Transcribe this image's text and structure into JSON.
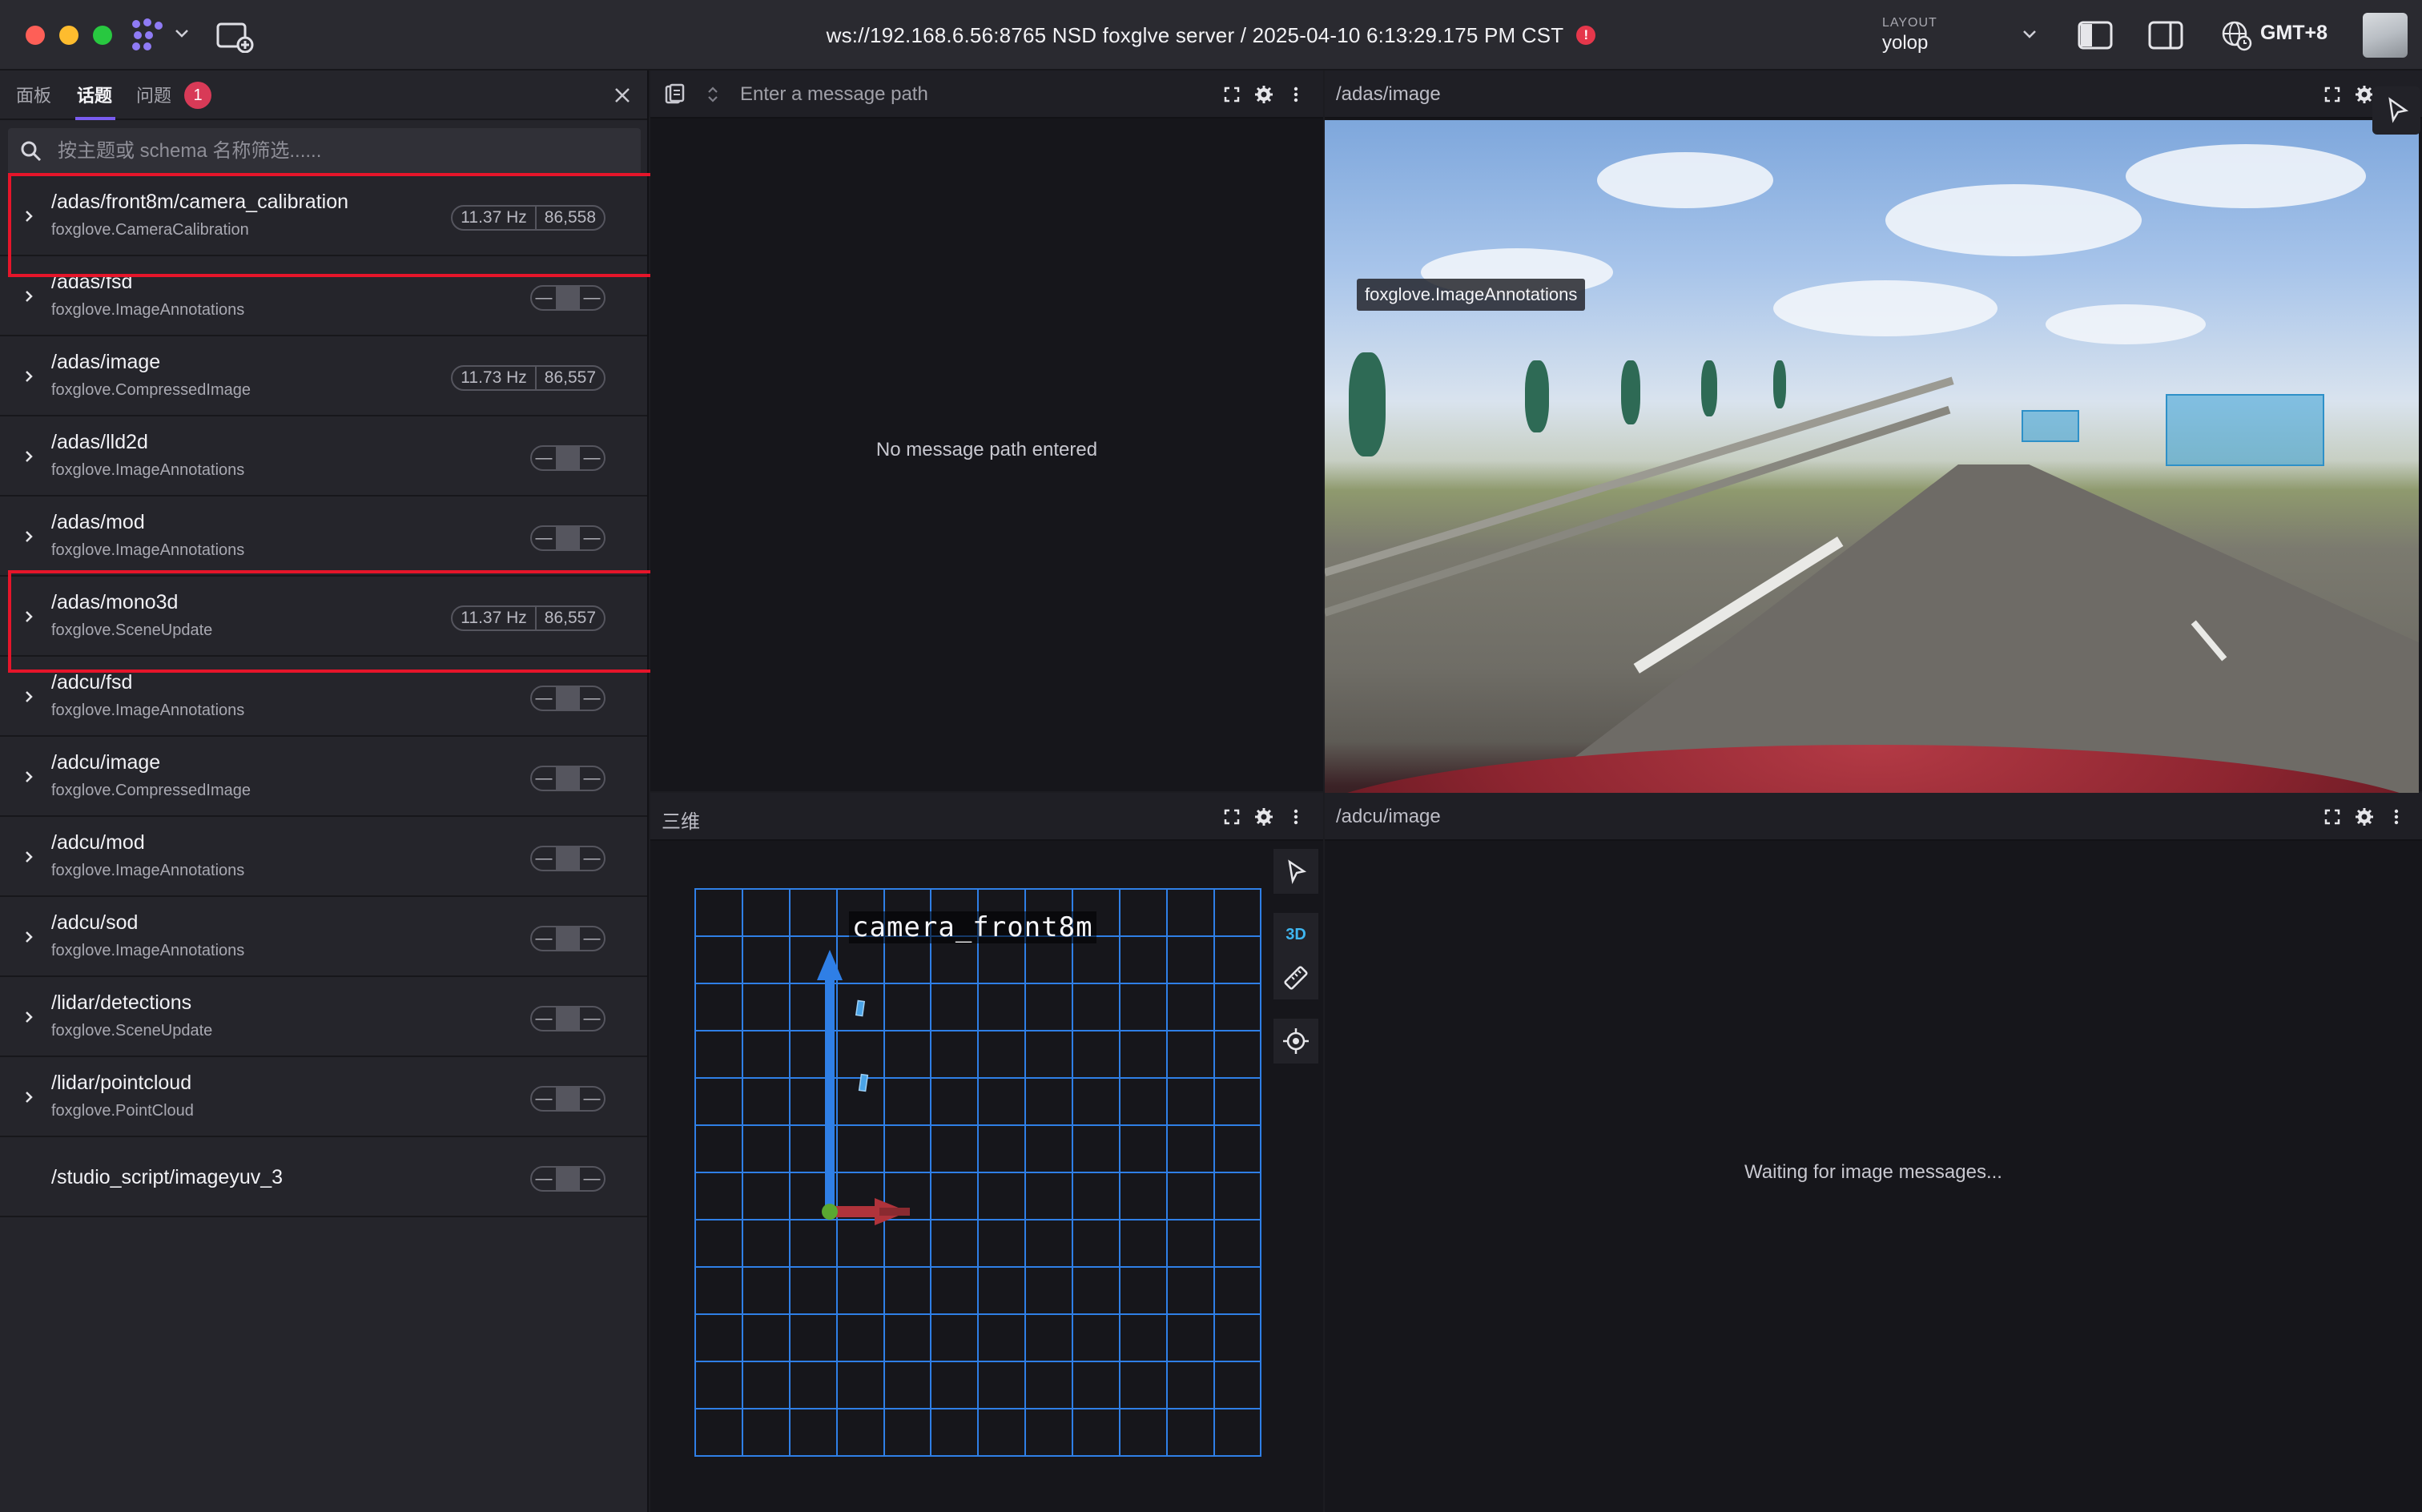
{
  "titlebar": {
    "connection_title": "ws://192.168.6.56:8765 NSD foxglve server / 2025-04-10 6:13:29.175 PM CST",
    "alert_glyph": "!",
    "layout_caption": "LAYOUT",
    "layout_name": "yolop",
    "timezone": "GMT+8",
    "icons": [
      "app-logo-icon",
      "chevron-down-icon",
      "add-window-icon",
      "left-sidebar-icon",
      "right-sidebar-icon",
      "globe-clock-icon"
    ]
  },
  "sidebar": {
    "tabs": [
      "面板",
      "话题",
      "问题"
    ],
    "active_tab": "话题",
    "issue_count": "1",
    "filter_placeholder": "按主题或 schema 名称筛选......",
    "topics": [
      {
        "name": "/adas/front8m/camera_calibration",
        "schema": "foxglove.CameraCalibration",
        "hz": "11.37 Hz",
        "count": "86,558",
        "highlighted": true
      },
      {
        "name": "/adas/fsd",
        "schema": "foxglove.ImageAnnotations",
        "hz": "—",
        "count": "—"
      },
      {
        "name": "/adas/image",
        "schema": "foxglove.CompressedImage",
        "hz": "11.73 Hz",
        "count": "86,557"
      },
      {
        "name": "/adas/lld2d",
        "schema": "foxglove.ImageAnnotations",
        "hz": "—",
        "count": "—"
      },
      {
        "name": "/adas/mod",
        "schema": "foxglove.ImageAnnotations",
        "hz": "—",
        "count": "—"
      },
      {
        "name": "/adas/mono3d",
        "schema": "foxglove.SceneUpdate",
        "hz": "11.37 Hz",
        "count": "86,557",
        "highlighted": true
      },
      {
        "name": "/adcu/fsd",
        "schema": "foxglove.ImageAnnotations",
        "hz": "—",
        "count": "—"
      },
      {
        "name": "/adcu/image",
        "schema": "foxglove.CompressedImage",
        "hz": "—",
        "count": "—"
      },
      {
        "name": "/adcu/mod",
        "schema": "foxglove.ImageAnnotations",
        "hz": "—",
        "count": "—"
      },
      {
        "name": "/adcu/sod",
        "schema": "foxglove.ImageAnnotations",
        "hz": "—",
        "count": "—"
      },
      {
        "name": "/lidar/detections",
        "schema": "foxglove.SceneUpdate",
        "hz": "—",
        "count": "—"
      },
      {
        "name": "/lidar/pointcloud",
        "schema": "foxglove.PointCloud",
        "hz": "—",
        "count": "—"
      },
      {
        "name": "/studio_script/imageyuv_3",
        "schema": "",
        "hz": "—",
        "count": "—"
      }
    ],
    "highlight_color": "#e6152a"
  },
  "panels": {
    "plot": {
      "placeholder": "Enter a message path",
      "empty_message": "No message path entered"
    },
    "adas_image": {
      "title": "/adas/image",
      "annotation_label": "foxglove.ImageAnnotations"
    },
    "three_d": {
      "title": "三维",
      "frame_label": "camera_front8m",
      "mode_label": "3D",
      "grid_color": "#2f7fe6"
    },
    "adcu_image": {
      "title": "/adcu/image",
      "waiting_message": "Waiting for image messages..."
    }
  },
  "colors": {
    "accent": "#7a5cf0",
    "badge": "#d83a57",
    "axis_x": "#b0333b",
    "axis_y": "#2f7fe6",
    "axis_origin": "#5aa831"
  }
}
